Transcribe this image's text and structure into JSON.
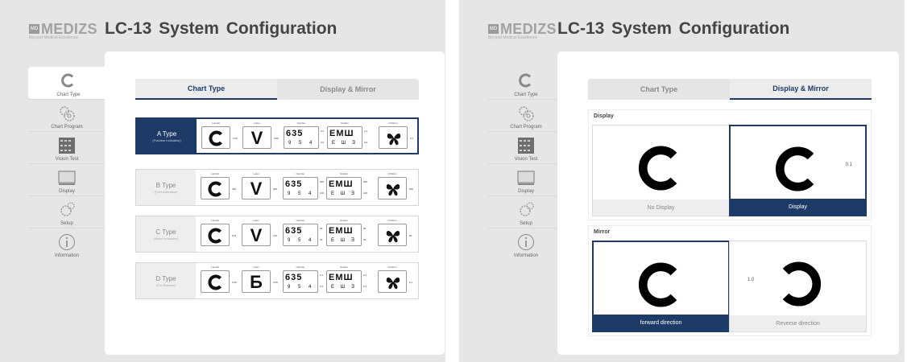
{
  "left": {
    "logo": {
      "mark": "MD",
      "name": "MEDIZS",
      "tagline": "Beyond Medical Excellence"
    },
    "title": "LC-13  System  Configuration",
    "sidebar": [
      {
        "label": "Chart Type",
        "icon": "landolt-c-icon",
        "active": true
      },
      {
        "label": "Chart Program",
        "icon": "gear-icon"
      },
      {
        "label": "Vision Test",
        "icon": "grid-icon"
      },
      {
        "label": "Display",
        "icon": "monitor-icon"
      },
      {
        "label": "Setup",
        "icon": "gear-icon"
      },
      {
        "label": "Information",
        "icon": "info-icon"
      }
    ],
    "tabs": [
      {
        "label": "Chart Type",
        "active": true
      },
      {
        "label": "Display & Mirror",
        "active": false
      }
    ],
    "chart_captions": [
      "Landolt",
      "Letter",
      "Number",
      "Snellen",
      "Children"
    ],
    "types": [
      {
        "name": "A Type",
        "sub": "(Fraction Indication)",
        "letter": "V",
        "landolt_val": "0.05",
        "letter_val": "0.05",
        "num_top": "635",
        "num_top_val": "0.1",
        "num_bot": "9 5 4",
        "num_bot_val": "0.2",
        "snel_top": "EMШ",
        "snel_top_val": "0.1",
        "snel_bot": "E Ш Ǝ",
        "snel_bot_val": "0.2",
        "child_val": "0.1"
      },
      {
        "name": "B Type",
        "sub": "(Feet Indication)",
        "letter": "V",
        "landolt_val": "400",
        "letter_val": "400",
        "num_top": "635",
        "num_top_val": "200",
        "num_bot": "9 5 4",
        "num_bot_val": "100",
        "snel_top": "EMШ",
        "snel_top_val": "200",
        "snel_bot": "E Ш Ǝ",
        "snel_bot_val": "100",
        "child_val": "200"
      },
      {
        "name": "C Type",
        "sub": "(Meter Indication)",
        "letter": "V",
        "landolt_val": "120",
        "letter_val": "120",
        "num_top": "635",
        "num_top_val": "60",
        "num_bot": "9 5 4",
        "num_bot_val": "30",
        "snel_top": "EMШ",
        "snel_top_val": "60",
        "snel_bot": "E Ш Ǝ",
        "snel_bot_val": "30",
        "child_val": "60"
      },
      {
        "name": "D Type",
        "sub": "(For Russian)",
        "letter": "Б",
        "landolt_val": "0.05",
        "letter_val": "0.05",
        "num_top": "635",
        "num_top_val": "0.1",
        "num_bot": "9 5 4",
        "num_bot_val": "0.2",
        "snel_top": "EMШ",
        "snel_top_val": "0.1",
        "snel_bot": "E Ш Ǝ",
        "snel_bot_val": "0.2",
        "child_val": "0.1"
      }
    ]
  },
  "right": {
    "logo": {
      "mark": "MD",
      "name": "MEDIZS",
      "tagline": "Beyond Medical Excellence"
    },
    "title": "LC-13  System  Configuration",
    "sidebar": [
      {
        "label": "Chart Type",
        "icon": "landolt-c-icon",
        "active": true
      },
      {
        "label": "Chart Program",
        "icon": "gear-icon"
      },
      {
        "label": "Vision Test",
        "icon": "grid-icon"
      },
      {
        "label": "Display",
        "icon": "monitor-icon"
      },
      {
        "label": "Setup",
        "icon": "gear-icon"
      },
      {
        "label": "Information",
        "icon": "info-icon"
      }
    ],
    "tabs": [
      {
        "label": "Chart Type",
        "active": false
      },
      {
        "label": "Display & Mirror",
        "active": true
      }
    ],
    "display": {
      "title": "Display",
      "options": [
        {
          "label": "No Display",
          "selected": false,
          "note": ""
        },
        {
          "label": "Display",
          "selected": true,
          "note": "0.1"
        }
      ]
    },
    "mirror": {
      "title": "Mirror",
      "options": [
        {
          "label": "forward direction",
          "selected": true,
          "note": ""
        },
        {
          "label": "Reverse direction",
          "selected": false,
          "note": "1.0"
        }
      ]
    }
  },
  "colors": {
    "accent": "#1d3b66",
    "background": "#e6e6e6",
    "panel": "#ffffff"
  }
}
